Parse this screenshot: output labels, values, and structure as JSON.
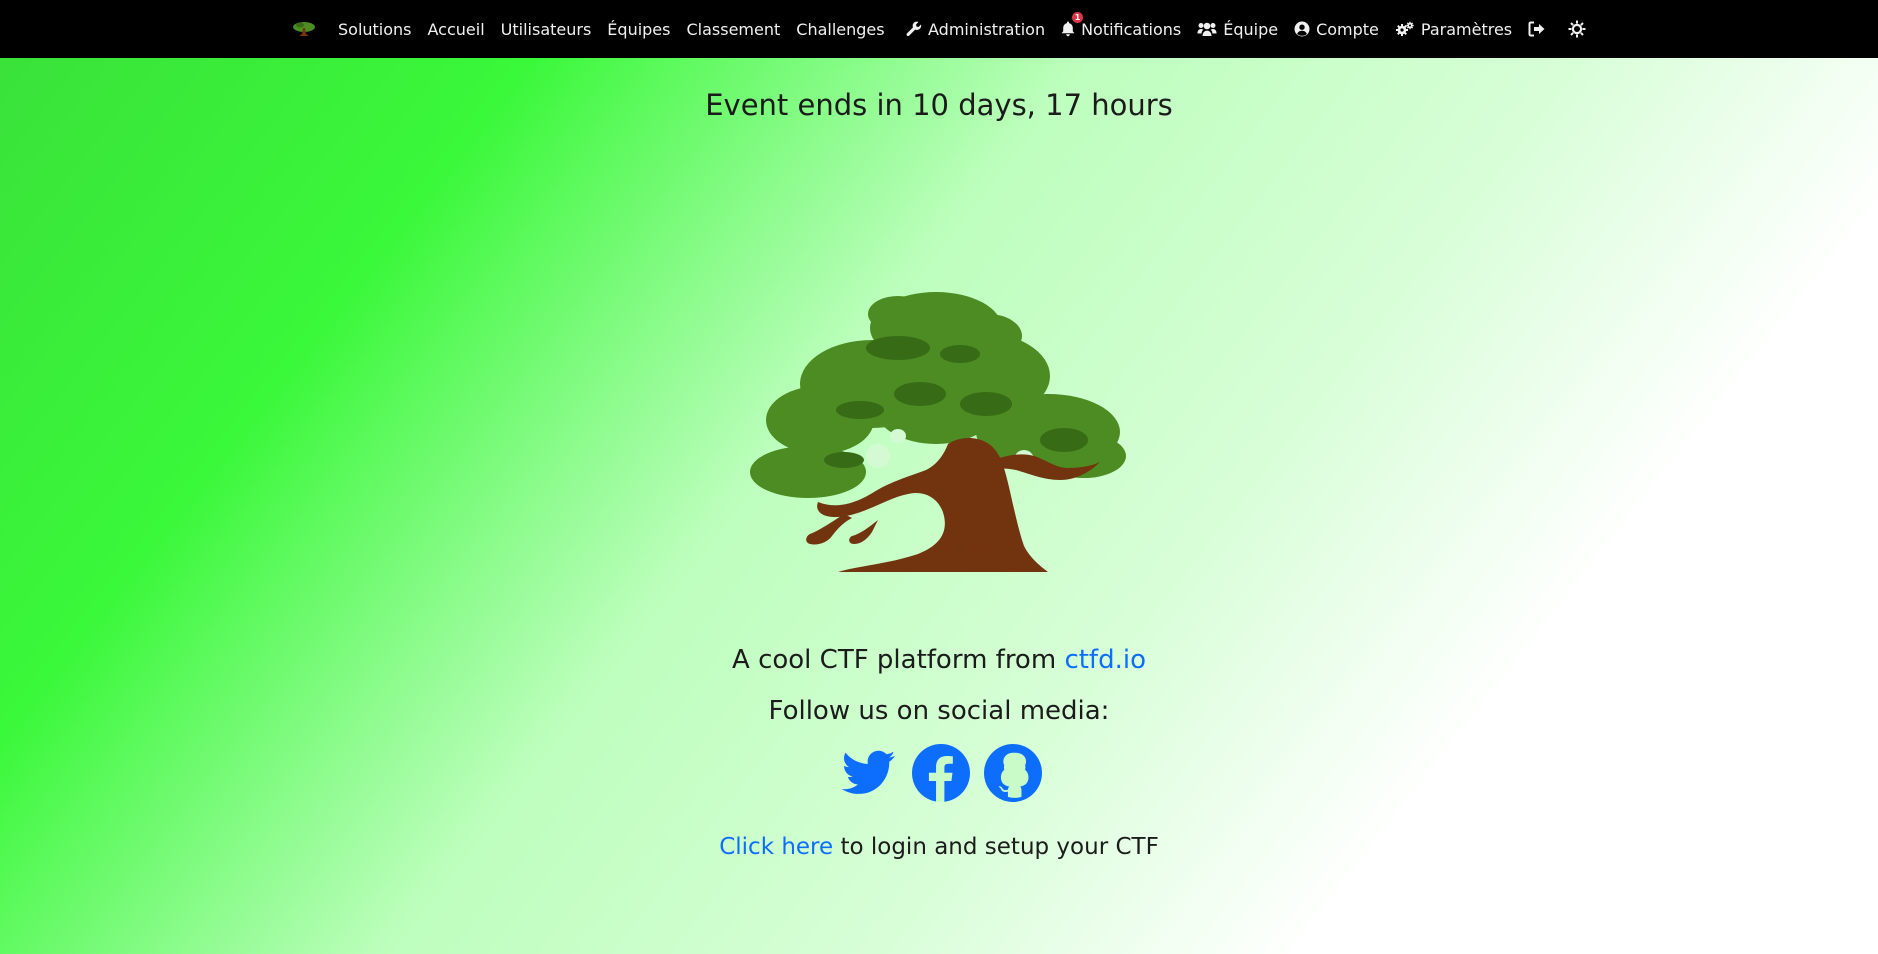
{
  "nav": {
    "brand_icon": "bonsai-logo-icon",
    "links": [
      {
        "label": "Solutions"
      },
      {
        "label": "Accueil"
      },
      {
        "label": "Utilisateurs"
      },
      {
        "label": "Équipes"
      },
      {
        "label": "Classement"
      },
      {
        "label": "Challenges"
      }
    ],
    "admin": {
      "label": "Administration",
      "icon": "wrench-icon"
    },
    "notifications": {
      "label": "Notifications",
      "icon": "bell-icon",
      "badge": "1"
    },
    "team": {
      "label": "Équipe",
      "icon": "users-icon"
    },
    "account": {
      "label": "Compte",
      "icon": "user-circle-icon"
    },
    "settings": {
      "label": "Paramètres",
      "icon": "cogs-icon"
    },
    "logout": {
      "icon": "sign-out-icon"
    },
    "theme": {
      "icon": "sun-icon"
    }
  },
  "main": {
    "countdown": "Event ends in 10 days, 17 hours",
    "tagline_prefix": "A cool CTF platform from ",
    "tagline_link": "ctfd.io",
    "follow": "Follow us on social media:",
    "social": [
      {
        "icon": "twitter-icon"
      },
      {
        "icon": "facebook-icon"
      },
      {
        "icon": "github-icon"
      }
    ],
    "login_link": "Click here",
    "login_suffix": " to login and setup your CTF"
  },
  "colors": {
    "navbar": "#000000",
    "link": "#0d6efd",
    "badge": "#dc3545",
    "tree_foliage": "#4c8c22",
    "tree_foliage_dark": "#376b16",
    "tree_trunk": "#72330f"
  }
}
